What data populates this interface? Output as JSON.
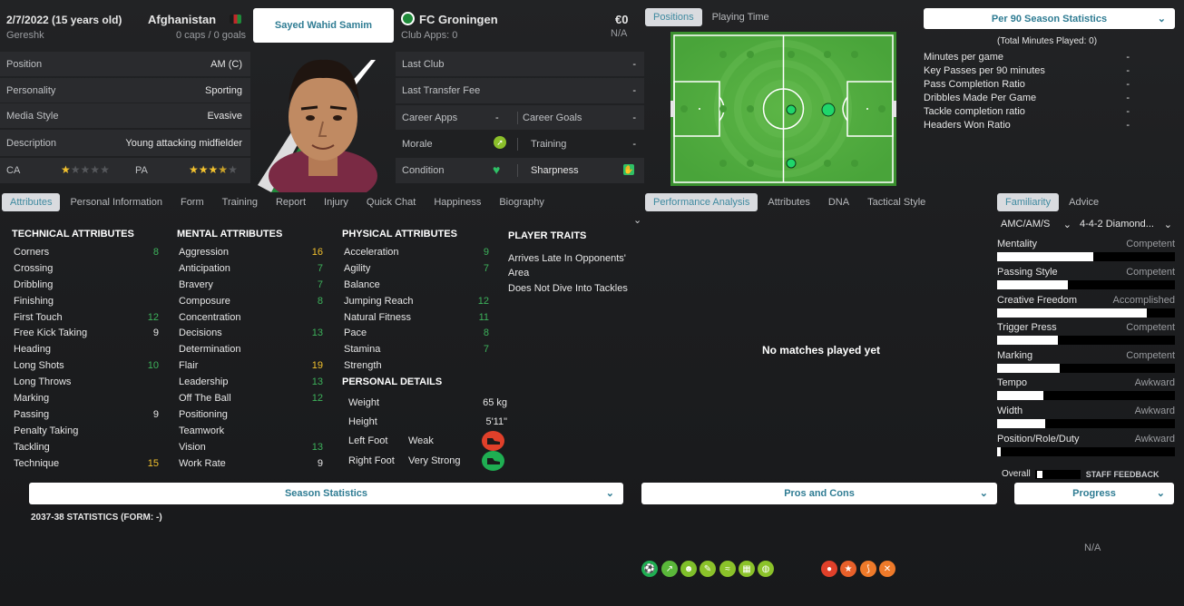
{
  "header": {
    "dob": "2/7/2022 (15 years old)",
    "birthplace": "Gereshk",
    "nation": "Afghanistan",
    "caps": "0 caps / 0 goals",
    "player_name": "Sayed Wahid Samim",
    "club": "FC Groningen",
    "club_apps": "Club Apps: 0",
    "value": "€0",
    "wage": "N/A"
  },
  "profile": [
    {
      "label": "Position",
      "value": "AM (C)"
    },
    {
      "label": "Personality",
      "value": "Sporting"
    },
    {
      "label": "Media Style",
      "value": "Evasive"
    },
    {
      "label": "Description",
      "value": "Young attacking midfielder"
    }
  ],
  "ability": {
    "ca_label": "CA",
    "pa_label": "PA",
    "ca_stars": 1,
    "pa_stars": 3.5
  },
  "club_info": {
    "last_club_label": "Last Club",
    "last_club": "-",
    "last_fee_label": "Last Transfer Fee",
    "last_fee": "-",
    "career_apps_label": "Career Apps",
    "career_apps": "-",
    "career_goals_label": "Career Goals",
    "career_goals": "-",
    "morale_label": "Morale",
    "training_label": "Training",
    "training": "-",
    "condition_label": "Condition",
    "sharpness_label": "Sharpness"
  },
  "player_tabs": [
    "Attributes",
    "Personal Information",
    "Form",
    "Training",
    "Report",
    "Injury",
    "Quick Chat",
    "Happiness",
    "Biography"
  ],
  "technical": {
    "title": "TECHNICAL ATTRIBUTES",
    "items": [
      {
        "n": "Corners",
        "v": "8",
        "c": "g"
      },
      {
        "n": "Crossing",
        "v": "",
        "c": "w"
      },
      {
        "n": "Dribbling",
        "v": "",
        "c": "w"
      },
      {
        "n": "Finishing",
        "v": "",
        "c": "w"
      },
      {
        "n": "First Touch",
        "v": "12",
        "c": "g"
      },
      {
        "n": "Free Kick Taking",
        "v": "9",
        "c": "w"
      },
      {
        "n": "Heading",
        "v": "",
        "c": "w"
      },
      {
        "n": "Long Shots",
        "v": "10",
        "c": "g"
      },
      {
        "n": "Long Throws",
        "v": "",
        "c": "w"
      },
      {
        "n": "Marking",
        "v": "",
        "c": "w"
      },
      {
        "n": "Passing",
        "v": "9",
        "c": "w"
      },
      {
        "n": "Penalty Taking",
        "v": "",
        "c": "w"
      },
      {
        "n": "Tackling",
        "v": "",
        "c": "w"
      },
      {
        "n": "Technique",
        "v": "15",
        "c": "y"
      }
    ]
  },
  "mental": {
    "title": "MENTAL ATTRIBUTES",
    "items": [
      {
        "n": "Aggression",
        "v": "16",
        "c": "y"
      },
      {
        "n": "Anticipation",
        "v": "7",
        "c": "g"
      },
      {
        "n": "Bravery",
        "v": "7",
        "c": "g"
      },
      {
        "n": "Composure",
        "v": "8",
        "c": "g"
      },
      {
        "n": "Concentration",
        "v": "",
        "c": "w"
      },
      {
        "n": "Decisions",
        "v": "13",
        "c": "g"
      },
      {
        "n": "Determination",
        "v": "",
        "c": "w"
      },
      {
        "n": "Flair",
        "v": "19",
        "c": "y"
      },
      {
        "n": "Leadership",
        "v": "13",
        "c": "g"
      },
      {
        "n": "Off The Ball",
        "v": "12",
        "c": "g"
      },
      {
        "n": "Positioning",
        "v": "",
        "c": "w"
      },
      {
        "n": "Teamwork",
        "v": "",
        "c": "w"
      },
      {
        "n": "Vision",
        "v": "13",
        "c": "g"
      },
      {
        "n": "Work Rate",
        "v": "9",
        "c": "w"
      }
    ]
  },
  "physical": {
    "title": "PHYSICAL ATTRIBUTES",
    "items": [
      {
        "n": "Acceleration",
        "v": "9",
        "c": "g"
      },
      {
        "n": "Agility",
        "v": "7",
        "c": "g"
      },
      {
        "n": "Balance",
        "v": "",
        "c": "w"
      },
      {
        "n": "Jumping Reach",
        "v": "12",
        "c": "g"
      },
      {
        "n": "Natural Fitness",
        "v": "11",
        "c": "g"
      },
      {
        "n": "Pace",
        "v": "8",
        "c": "g"
      },
      {
        "n": "Stamina",
        "v": "7",
        "c": "g"
      },
      {
        "n": "Strength",
        "v": "",
        "c": "w"
      }
    ]
  },
  "personal": {
    "title": "PERSONAL DETAILS",
    "weight_label": "Weight",
    "weight": "65 kg",
    "height_label": "Height",
    "height": "5'11\"",
    "left_foot_label": "Left Foot",
    "left_foot": "Weak",
    "right_foot_label": "Right Foot",
    "right_foot": "Very Strong"
  },
  "traits": {
    "title": "PLAYER TRAITS",
    "items": [
      "Arrives Late In Opponents' Area",
      "Does Not Dive Into Tackles"
    ]
  },
  "pitch_tabs": [
    "Positions",
    "Playing Time"
  ],
  "stats_panel": {
    "dropdown": "Per 90 Season Statistics",
    "total": "(Total Minutes Played: 0)",
    "rows": [
      {
        "label": "Minutes per game",
        "value": "-"
      },
      {
        "label": "Key Passes per 90 minutes",
        "value": "-"
      },
      {
        "label": "Pass Completion Ratio",
        "value": "-"
      },
      {
        "label": "Dribbles Made Per Game",
        "value": "-"
      },
      {
        "label": "Tackle completion ratio",
        "value": "-"
      },
      {
        "label": "Headers Won Ratio",
        "value": "-"
      }
    ]
  },
  "perf_tabs": [
    "Performance Analysis",
    "Attributes",
    "DNA",
    "Tactical Style"
  ],
  "perf_message": "No matches played yet",
  "fam_tabs": [
    "Familiarity",
    "Advice"
  ],
  "fam_selects": {
    "role": "AMC/AM/S",
    "formation": "4-4-2 Diamond..."
  },
  "familiarity": [
    {
      "label": "Mentality",
      "level": "Competent",
      "fill": 0.54
    },
    {
      "label": "Passing Style",
      "level": "Competent",
      "fill": 0.4
    },
    {
      "label": "Creative Freedom",
      "level": "Accomplished",
      "fill": 0.84
    },
    {
      "label": "Trigger Press",
      "level": "Competent",
      "fill": 0.34
    },
    {
      "label": "Marking",
      "level": "Competent",
      "fill": 0.35
    },
    {
      "label": "Tempo",
      "level": "Awkward",
      "fill": 0.26
    },
    {
      "label": "Width",
      "level": "Awkward",
      "fill": 0.27
    },
    {
      "label": "Position/Role/Duty",
      "level": "Awkward",
      "fill": 0.02
    }
  ],
  "overall": {
    "label": "Overall",
    "feedback": "STAFF FEEDBACK"
  },
  "bottom": {
    "season_stats": "Season Statistics",
    "pros_cons": "Pros and Cons",
    "progress": "Progress",
    "form_line": "2037-38 STATISTICS (FORM: -)",
    "na": "N/A"
  },
  "colors": {
    "accent": "#2f7c93",
    "green": "#3db25b",
    "yellow": "#f2c12e",
    "pitch": "#4aa23c"
  }
}
